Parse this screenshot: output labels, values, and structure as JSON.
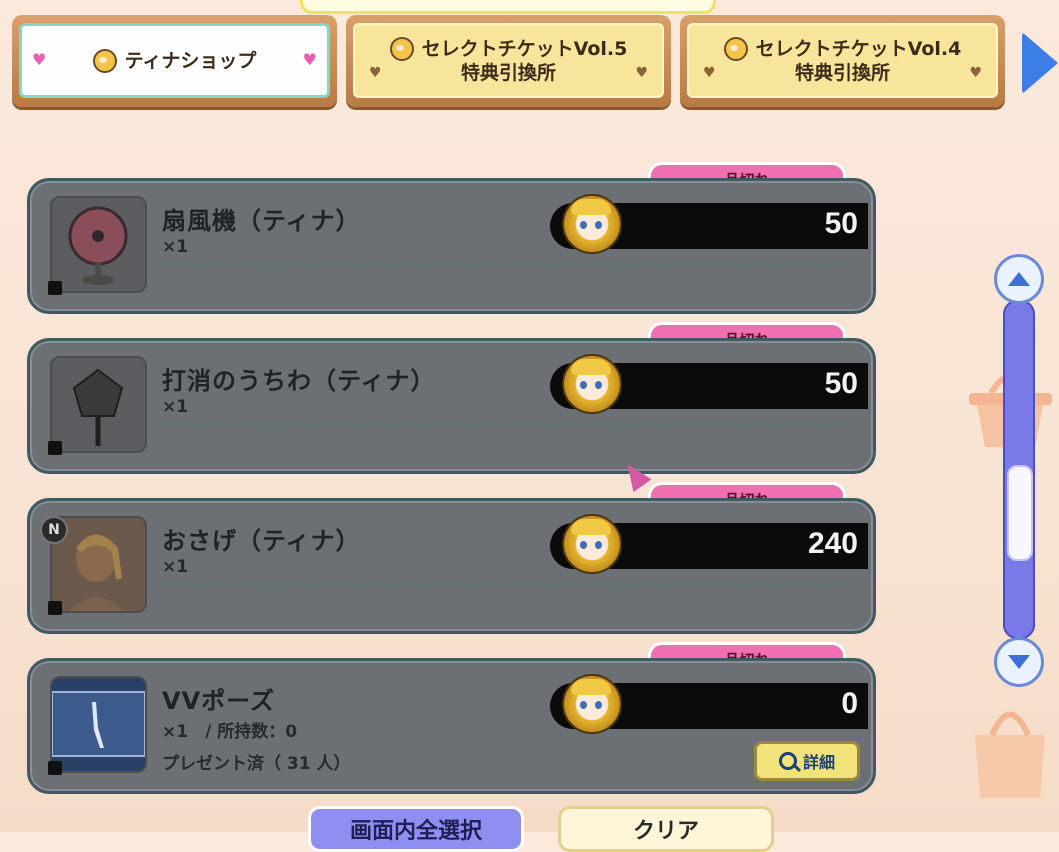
{
  "tabs": [
    {
      "line1": "ティナショップ",
      "line2": "",
      "active": true
    },
    {
      "line1": "セレクトチケットVol.5",
      "line2": "特典引換所",
      "active": false
    },
    {
      "line1": "セレクトチケットVol.4",
      "line2": "特典引換所",
      "active": false
    }
  ],
  "soldout_label": "品切れ",
  "items": [
    {
      "name": "扇風機（ティナ）",
      "qty": "×1",
      "extra": "",
      "price": "50"
    },
    {
      "name": "打消のうちわ（ティナ）",
      "qty": "×1",
      "extra": "",
      "price": "50"
    },
    {
      "name": "おさげ（ティナ）",
      "qty": "×1",
      "extra": "",
      "price": "240",
      "rank": "N"
    },
    {
      "name": "VVポーズ",
      "qty": "×1　/ 所持数：0",
      "extra": "プレゼント済（ 31 人）",
      "price": "0",
      "detail_label": "詳細"
    }
  ],
  "bottom": {
    "select_all_label": "画面内全選択",
    "clear_label": "クリア"
  },
  "colors": {
    "accent_pink": "#ef6fb0",
    "scrollbar": "#7a79e8",
    "tab_gold": "#f6e59a"
  }
}
